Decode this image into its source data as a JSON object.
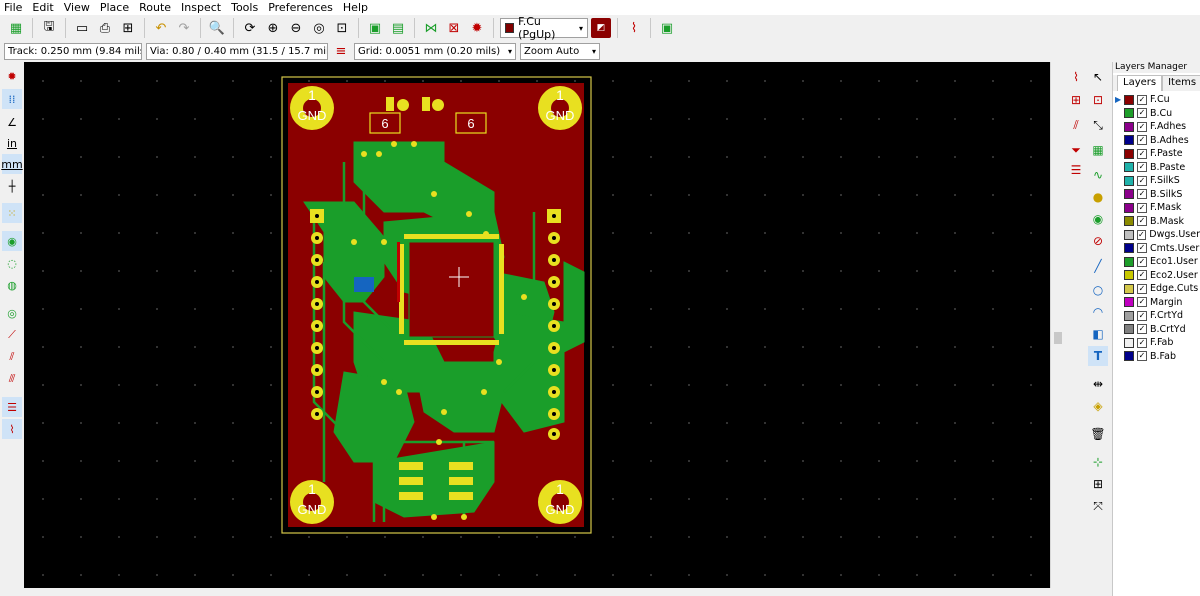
{
  "menu": [
    "File",
    "Edit",
    "View",
    "Place",
    "Route",
    "Inspect",
    "Tools",
    "Preferences",
    "Help"
  ],
  "toolbar": {
    "active_layer": "F.Cu (PgUp)",
    "active_layer_color": "#800000"
  },
  "options_bar": {
    "track": "Track: 0.250 mm (9.84 mils) *",
    "via": "Via: 0.80 / 0.40 mm (31.5 / 15.7 mils) *",
    "grid": "Grid: 0.0051 mm (0.20 mils)",
    "zoom": "Zoom Auto"
  },
  "left_toolbar": {
    "units_in": "in",
    "units_mm": "mm"
  },
  "board": {
    "mounting_hole_number": "1",
    "mounting_hole_net": "GND",
    "pad_label": "6",
    "copper_color": "#8b0000",
    "track_color": "#1a9e2a",
    "outline_color": "#d4c84a",
    "pad_color": "#e0d020"
  },
  "layers_manager": {
    "title": "Layers Manager",
    "tabs": [
      "Layers",
      "Items"
    ],
    "active_tab": "Layers",
    "layers": [
      {
        "name": "F.Cu",
        "color": "#8b0000",
        "active": true
      },
      {
        "name": "B.Cu",
        "color": "#1e9e2a",
        "active": false
      },
      {
        "name": "F.Adhes",
        "color": "#8b008b",
        "active": false
      },
      {
        "name": "B.Adhes",
        "color": "#00008b",
        "active": false
      },
      {
        "name": "F.Paste",
        "color": "#8b0000",
        "active": false
      },
      {
        "name": "B.Paste",
        "color": "#20b2aa",
        "active": false
      },
      {
        "name": "F.SilkS",
        "color": "#20b2aa",
        "active": false
      },
      {
        "name": "B.SilkS",
        "color": "#8b008b",
        "active": false
      },
      {
        "name": "F.Mask",
        "color": "#8b008b",
        "active": false
      },
      {
        "name": "B.Mask",
        "color": "#8b8b00",
        "active": false
      },
      {
        "name": "Dwgs.User",
        "color": "#c0c0c0",
        "active": false
      },
      {
        "name": "Cmts.User",
        "color": "#00008b",
        "active": false
      },
      {
        "name": "Eco1.User",
        "color": "#1e9e2a",
        "active": false
      },
      {
        "name": "Eco2.User",
        "color": "#c8c800",
        "active": false
      },
      {
        "name": "Edge.Cuts",
        "color": "#d4c84a",
        "active": false
      },
      {
        "name": "Margin",
        "color": "#c000c0",
        "active": false
      },
      {
        "name": "F.CrtYd",
        "color": "#a0a0a0",
        "active": false
      },
      {
        "name": "B.CrtYd",
        "color": "#808080",
        "active": false
      },
      {
        "name": "F.Fab",
        "color": "#f0f0f0",
        "active": false
      },
      {
        "name": "B.Fab",
        "color": "#00008b",
        "active": false
      }
    ]
  }
}
